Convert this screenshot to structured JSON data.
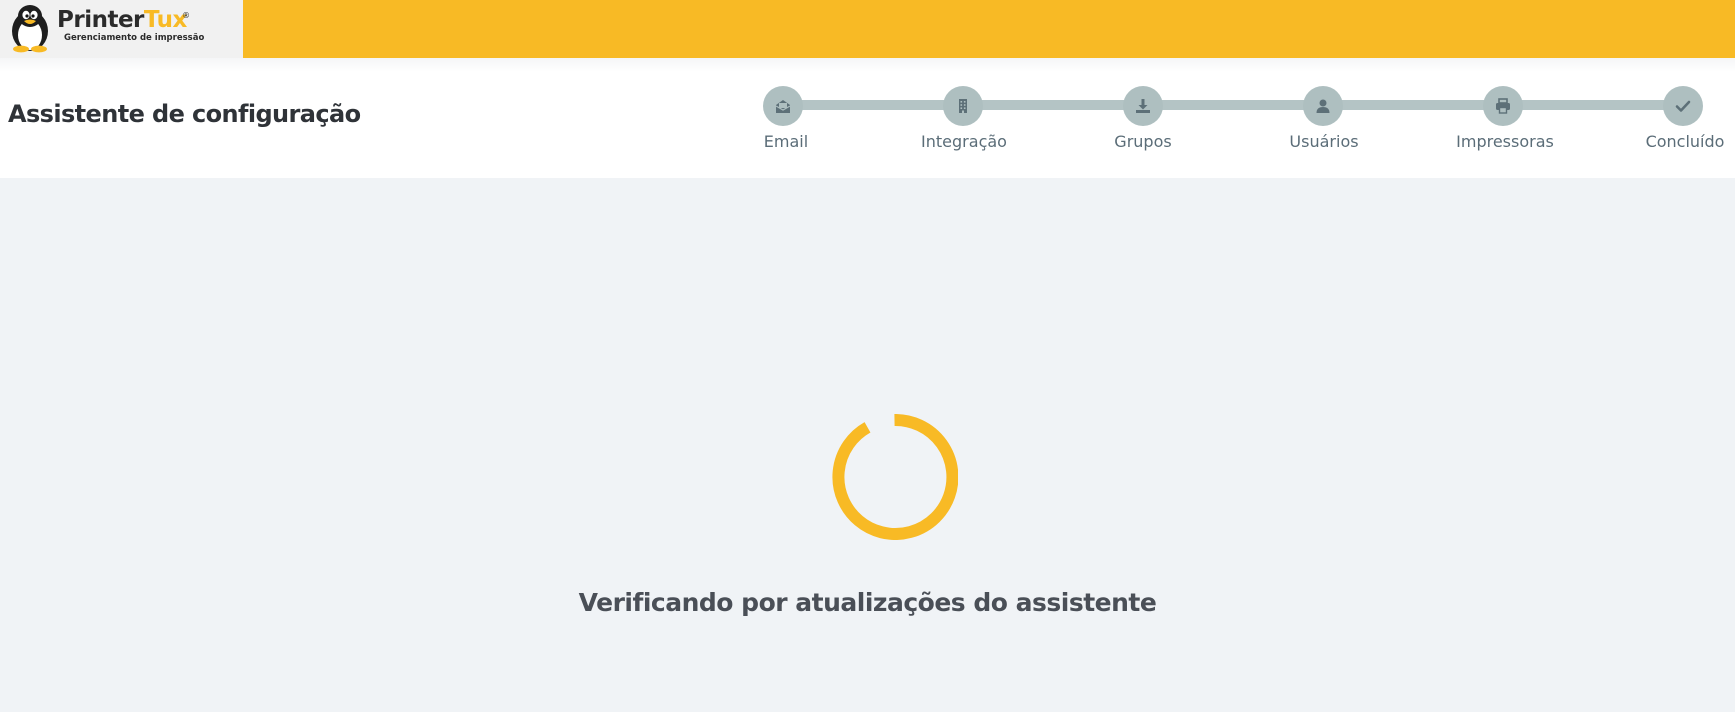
{
  "brand": {
    "name_part1": "Printer",
    "name_part2": "Tux",
    "registered": "®",
    "tagline": "Gerenciamento de impressão",
    "accent_color": "#f8ba25"
  },
  "header": {
    "title": "Assistente de configuração"
  },
  "stepper": {
    "steps": [
      {
        "label": "Email",
        "icon": "envelope-open-icon"
      },
      {
        "label": "Integração",
        "icon": "building-icon"
      },
      {
        "label": "Grupos",
        "icon": "download-icon"
      },
      {
        "label": "Usuários",
        "icon": "user-icon"
      },
      {
        "label": "Impressoras",
        "icon": "printer-icon"
      },
      {
        "label": "Concluído",
        "icon": "check-icon"
      }
    ]
  },
  "main": {
    "status_text": "Verificando por atualizações do assistente",
    "spinner_color": "#f8ba25"
  }
}
